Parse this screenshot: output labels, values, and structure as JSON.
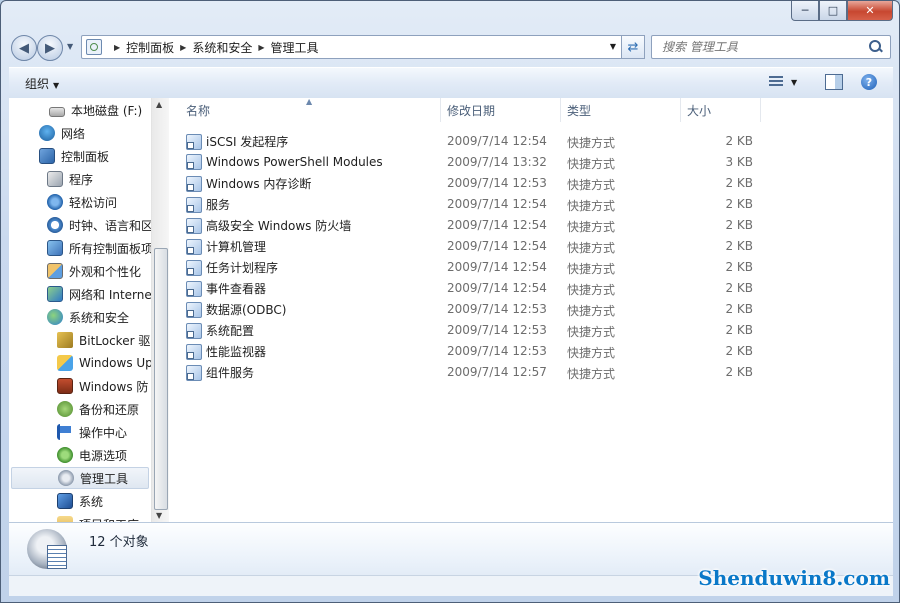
{
  "address": {
    "crumbs": [
      "控制面板",
      "系统和安全",
      "管理工具"
    ]
  },
  "search": {
    "placeholder": "搜索 管理工具"
  },
  "toolbar": {
    "organize_label": "组织"
  },
  "nav": {
    "items": [
      {
        "label": "本地磁盘 (F:)",
        "icon": "drive-icon"
      },
      {
        "label": "网络",
        "icon": "network-icon"
      },
      {
        "label": "控制面板",
        "icon": "control-panel-icon"
      },
      {
        "label": "程序",
        "icon": "programs-icon"
      },
      {
        "label": "轻松访问",
        "icon": "ease-of-access-icon"
      },
      {
        "label": "时钟、语言和区",
        "icon": "clock-icon"
      },
      {
        "label": "所有控制面板项",
        "icon": "all-items-icon"
      },
      {
        "label": "外观和个性化",
        "icon": "appearance-icon"
      },
      {
        "label": "网络和 Interne",
        "icon": "network-internet-icon"
      },
      {
        "label": "系统和安全",
        "icon": "security-icon"
      },
      {
        "label": "BitLocker 驱",
        "icon": "bitlocker-icon"
      },
      {
        "label": "Windows Up",
        "icon": "windows-update-icon"
      },
      {
        "label": "Windows 防",
        "icon": "firewall-icon"
      },
      {
        "label": "备份和还原",
        "icon": "backup-icon"
      },
      {
        "label": "操作中心",
        "icon": "flag-icon"
      },
      {
        "label": "电源选项",
        "icon": "power-icon"
      },
      {
        "label": "管理工具",
        "icon": "admin-tools-icon"
      },
      {
        "label": "系统",
        "icon": "system-icon"
      },
      {
        "label": "项目和工序",
        "icon": "folder-icon"
      }
    ]
  },
  "columns": {
    "name": "名称",
    "date": "修改日期",
    "type": "类型",
    "size": "大小"
  },
  "files": [
    {
      "name": "iSCSI 发起程序",
      "date": "2009/7/14 12:54",
      "type": "快捷方式",
      "size": "2 KB"
    },
    {
      "name": "Windows PowerShell Modules",
      "date": "2009/7/14 13:32",
      "type": "快捷方式",
      "size": "3 KB"
    },
    {
      "name": "Windows 内存诊断",
      "date": "2009/7/14 12:53",
      "type": "快捷方式",
      "size": "2 KB"
    },
    {
      "name": "服务",
      "date": "2009/7/14 12:54",
      "type": "快捷方式",
      "size": "2 KB"
    },
    {
      "name": "高级安全 Windows 防火墙",
      "date": "2009/7/14 12:54",
      "type": "快捷方式",
      "size": "2 KB"
    },
    {
      "name": "计算机管理",
      "date": "2009/7/14 12:54",
      "type": "快捷方式",
      "size": "2 KB"
    },
    {
      "name": "任务计划程序",
      "date": "2009/7/14 12:54",
      "type": "快捷方式",
      "size": "2 KB"
    },
    {
      "name": "事件查看器",
      "date": "2009/7/14 12:54",
      "type": "快捷方式",
      "size": "2 KB"
    },
    {
      "name": "数据源(ODBC)",
      "date": "2009/7/14 12:53",
      "type": "快捷方式",
      "size": "2 KB"
    },
    {
      "name": "系统配置",
      "date": "2009/7/14 12:53",
      "type": "快捷方式",
      "size": "2 KB"
    },
    {
      "name": "性能监视器",
      "date": "2009/7/14 12:53",
      "type": "快捷方式",
      "size": "2 KB"
    },
    {
      "name": "组件服务",
      "date": "2009/7/14 12:57",
      "type": "快捷方式",
      "size": "2 KB"
    }
  ],
  "details": {
    "count_text": "12 个对象"
  },
  "watermark": "Shenduwin8.com"
}
